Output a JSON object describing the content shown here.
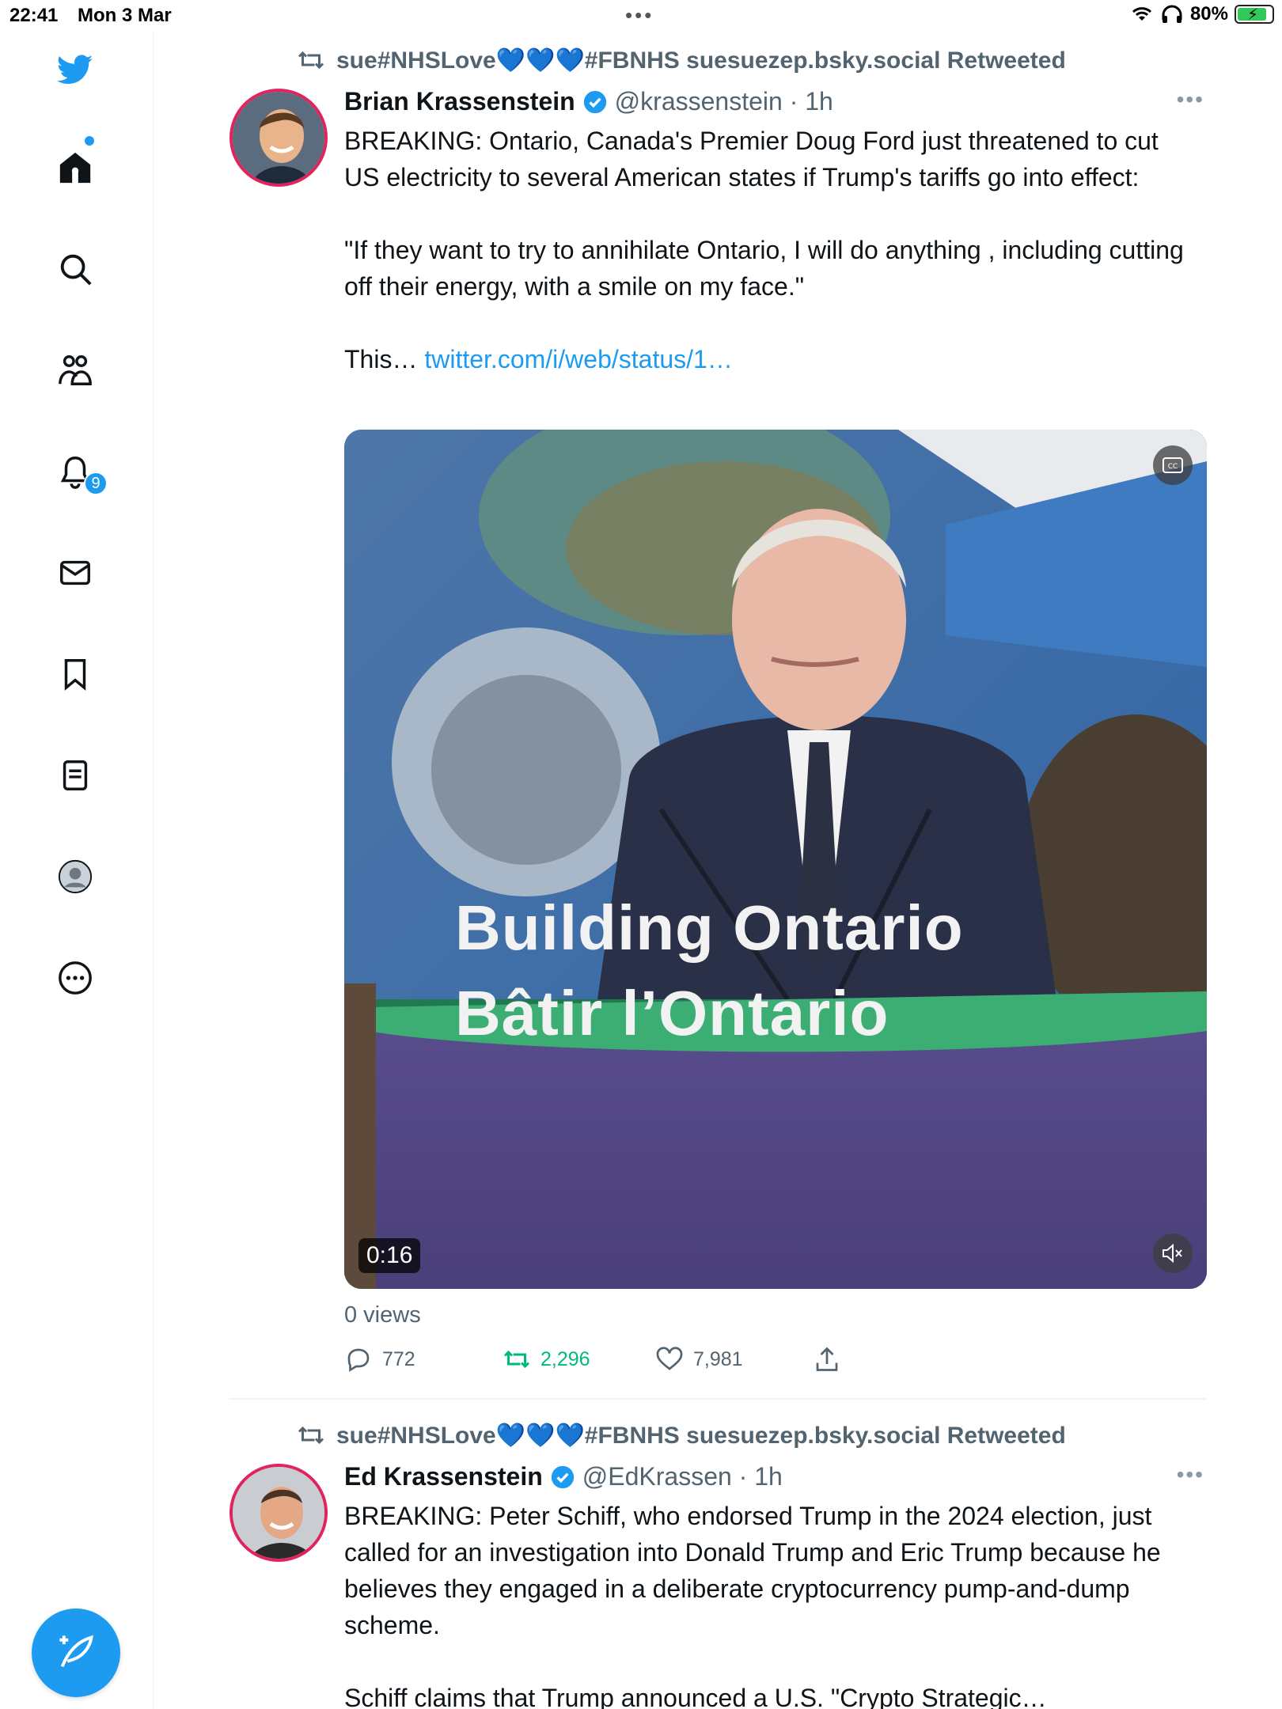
{
  "status_bar": {
    "time": "22:41",
    "date": "Mon 3 Mar",
    "battery": "80%"
  },
  "sidebar": {
    "notifications_badge": "9",
    "items": [
      "twitter-logo",
      "home-icon",
      "search-icon",
      "communities-icon",
      "notifications-icon",
      "messages-icon",
      "bookmarks-icon",
      "lists-icon",
      "profile-icon",
      "more-icon"
    ]
  },
  "tweets": [
    {
      "retweeted_by": "sue#NHSLove💙💙💙#FBNHS suesuezep.bsky.social Retweeted",
      "name": "Brian Krassenstein",
      "handle": "@krassenstein · 1h",
      "text_1": "BREAKING: Ontario, Canada's Premier Doug Ford just threatened to cut US electricity to several American states if Trump's tariffs go into effect:",
      "text_2": "\"If they want to try to annihilate Ontario, I will do anything , including cutting off their energy, with a smile on my face.\"",
      "text_3_prefix": "This… ",
      "link": "twitter.com/i/web/status/1…",
      "video": {
        "duration": "0:16",
        "banner_line1": "Building Ontario",
        "banner_line2": "Bâtir l’Ontario"
      },
      "views": "0 views",
      "replies": "772",
      "retweets": "2,296",
      "likes": "7,981"
    },
    {
      "retweeted_by": "sue#NHSLove💙💙💙#FBNHS suesuezep.bsky.social Retweeted",
      "name": "Ed Krassenstein",
      "handle": "@EdKrassen · 1h",
      "text_1": "BREAKING: Peter Schiff, who endorsed Trump in the 2024 election, just called for an investigation into Donald Trump and Eric Trump because he believes they engaged in a deliberate cryptocurrency pump-and-dump scheme.",
      "text_2": "Schiff claims that Trump announced a U.S. \"Crypto Strategic…"
    }
  ],
  "colors": {
    "accent": "#1d9bf0",
    "retweet": "#00ba7c",
    "secondary_text": "#536471",
    "avatar_ring": "#e0245e"
  }
}
